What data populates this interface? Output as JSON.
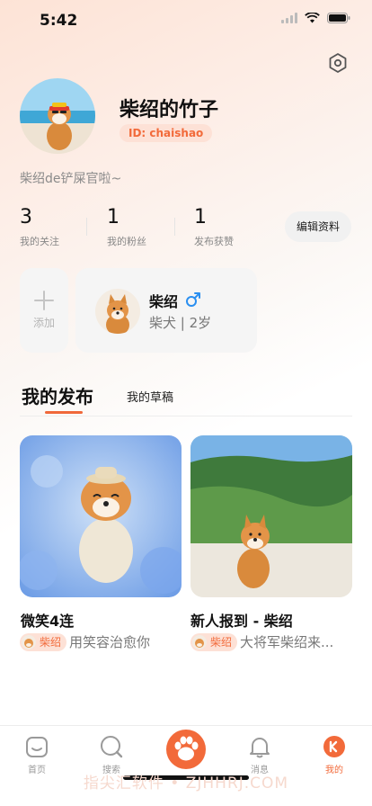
{
  "status_bar": {
    "time": "5:42"
  },
  "profile": {
    "name": "柴绍的竹子",
    "id_label": "ID: chaishao",
    "bio": "柴绍de铲屎官啦~"
  },
  "stats": [
    {
      "value": "3",
      "label": "我的关注"
    },
    {
      "value": "1",
      "label": "我的粉丝"
    },
    {
      "value": "1",
      "label": "发布获赞"
    }
  ],
  "edit_button": "编辑资料",
  "add_pet_label": "添加",
  "pet": {
    "name": "柴绍",
    "gender_icon": "male-icon",
    "breed_age": "柴犬 | 2岁"
  },
  "tabs": {
    "active": "我的发布",
    "other": "我的草稿"
  },
  "posts": [
    {
      "title": "微笑4连",
      "pet_tag": "柴绍",
      "desc": "用笑容治愈你"
    },
    {
      "title": "新人报到 - 柴绍",
      "pet_tag": "柴绍",
      "desc": "大将军柴绍来..."
    }
  ],
  "tabbar": [
    {
      "label": "首页",
      "icon": "home-icon"
    },
    {
      "label": "搜索",
      "icon": "search-icon"
    },
    {
      "label": "",
      "icon": "paw-icon"
    },
    {
      "label": "消息",
      "icon": "bell-icon"
    },
    {
      "label": "我的",
      "icon": "profile-icon"
    }
  ],
  "watermark": "指尖汇软件 • ZJHHRJ.COM",
  "colors": {
    "accent": "#f26a3a",
    "chip_bg": "#fde1d6",
    "male_blue": "#2a8ff0"
  }
}
